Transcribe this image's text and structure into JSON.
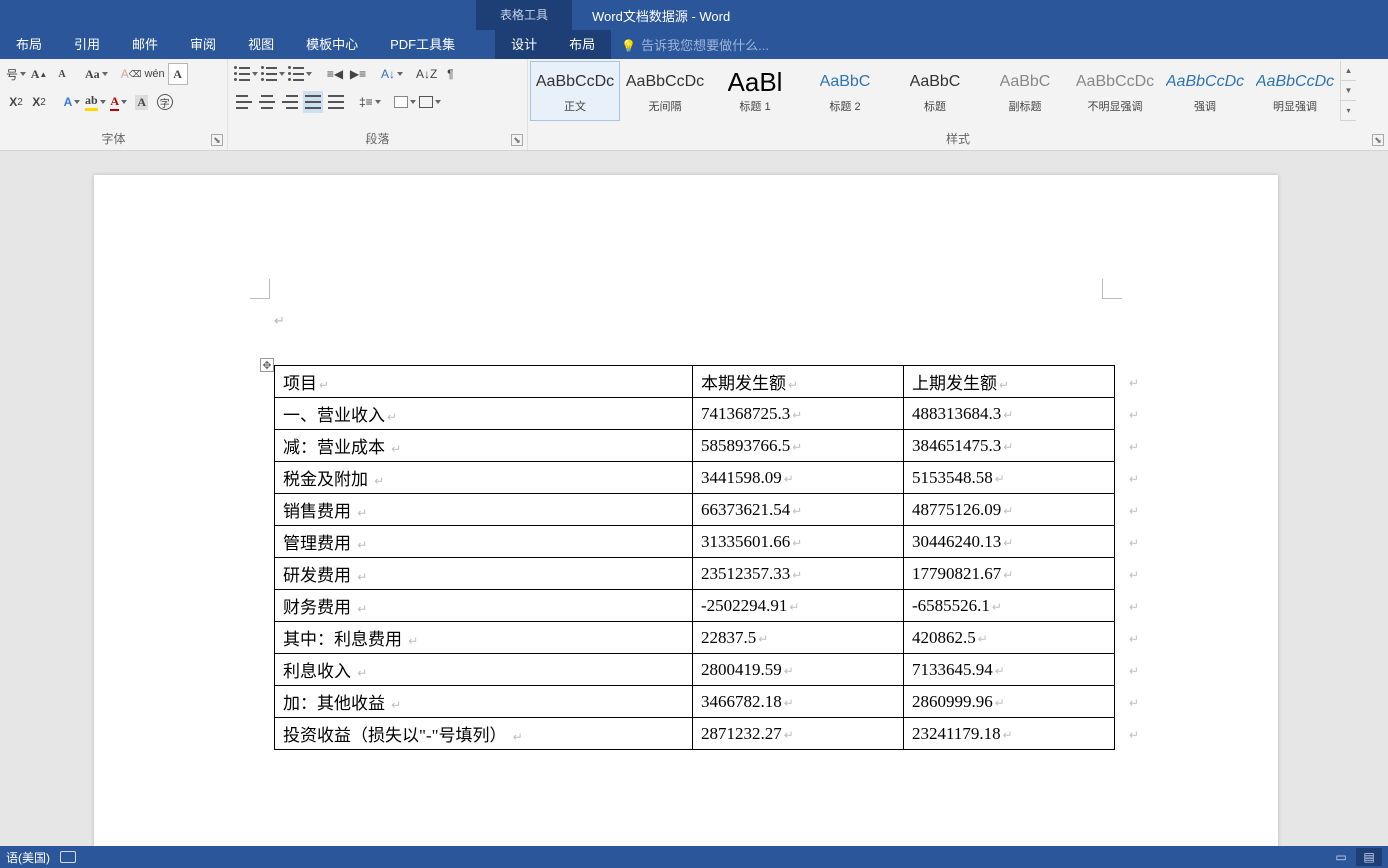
{
  "window": {
    "tool_context": "表格工具",
    "title": "Word文档数据源 - Word"
  },
  "tabs": {
    "layout1": "布局",
    "ref": "引用",
    "mail": "邮件",
    "review": "审阅",
    "view": "视图",
    "template": "模板中心",
    "pdf": "PDF工具集",
    "design": "设计",
    "layout2": "布局",
    "tellme": "告诉我您想要做什么..."
  },
  "ribbon": {
    "font_sub": "号",
    "group_font": "字体",
    "group_para": "段落",
    "group_style": "样式"
  },
  "styles": [
    {
      "preview": "AaBbCcDc",
      "name": "正文",
      "cls": ""
    },
    {
      "preview": "AaBbCcDc",
      "name": "无间隔",
      "cls": ""
    },
    {
      "preview": "AaBl",
      "name": "标题 1",
      "cls": "big"
    },
    {
      "preview": "AaBbC",
      "name": "标题 2",
      "cls": "blue"
    },
    {
      "preview": "AaBbC",
      "name": "标题",
      "cls": ""
    },
    {
      "preview": "AaBbC",
      "name": "副标题",
      "cls": "grey"
    },
    {
      "preview": "AaBbCcDc",
      "name": "不明显强调",
      "cls": "grey"
    },
    {
      "preview": "AaBbCcDc",
      "name": "强调",
      "cls": "lightblue"
    },
    {
      "preview": "AaBbCcDc",
      "name": "明显强调",
      "cls": "lightblue"
    }
  ],
  "table": {
    "headers": [
      "项目",
      "本期发生额",
      "上期发生额"
    ],
    "rows": [
      [
        "一、营业收入",
        "741368725.3",
        "488313684.3"
      ],
      [
        "减：营业成本  ",
        "585893766.5",
        "384651475.3"
      ],
      [
        "税金及附加  ",
        "3441598.09",
        "5153548.58"
      ],
      [
        "销售费用  ",
        "66373621.54",
        "48775126.09"
      ],
      [
        "管理费用  ",
        "31335601.66",
        "30446240.13"
      ],
      [
        "研发费用  ",
        "23512357.33",
        "17790821.67"
      ],
      [
        "财务费用  ",
        "-2502294.91",
        "-6585526.1"
      ],
      [
        "其中：利息费用  ",
        "22837.5",
        "420862.5"
      ],
      [
        "利息收入  ",
        "2800419.59",
        "7133645.94"
      ],
      [
        "加：其他收益  ",
        "3466782.18",
        "2860999.96"
      ],
      [
        "投资收益（损失以\"-\"号填列）  ",
        "2871232.27",
        "23241179.18"
      ]
    ]
  },
  "status": {
    "lang": "语(美国)"
  }
}
